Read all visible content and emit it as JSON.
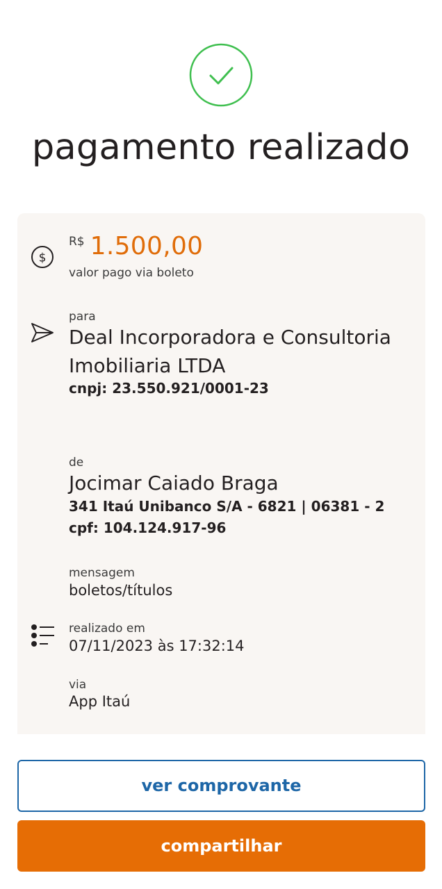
{
  "header": {
    "title": "pagamento realizado",
    "success_icon": "checkmark-circle-icon",
    "success_color": "#3fbf4f"
  },
  "payment": {
    "currency": "R$",
    "amount": "1.500,00",
    "amount_label": "valor pago via boleto",
    "amount_color": "#e06d0a",
    "icon": "dollar-circle-icon"
  },
  "recipient": {
    "label": "para",
    "name_line1": "Deal Incorporadora e Consultoria",
    "name_line2": "Imobiliaria LTDA",
    "document": "cnpj: 23.550.921/0001-23",
    "icon": "send-icon"
  },
  "payer": {
    "label": "de",
    "name": "Jocimar Caiado Braga",
    "bank": "341 Itaú Unibanco S/A - 6821 | 06381 - 2",
    "document": " cpf: 104.124.917-96"
  },
  "message": {
    "label": "mensagem",
    "value": "boletos/títulos"
  },
  "details": {
    "date_label": "realizado em",
    "date_value": "07/11/2023 às 17:32:14",
    "channel_label": "via",
    "channel_value": "App Itaú",
    "icon": "list-icon"
  },
  "actions": {
    "receipt_label": "ver comprovante",
    "share_label": "compartilhar",
    "outline_color": "#1d66a7",
    "primary_color": "#e66d05"
  }
}
